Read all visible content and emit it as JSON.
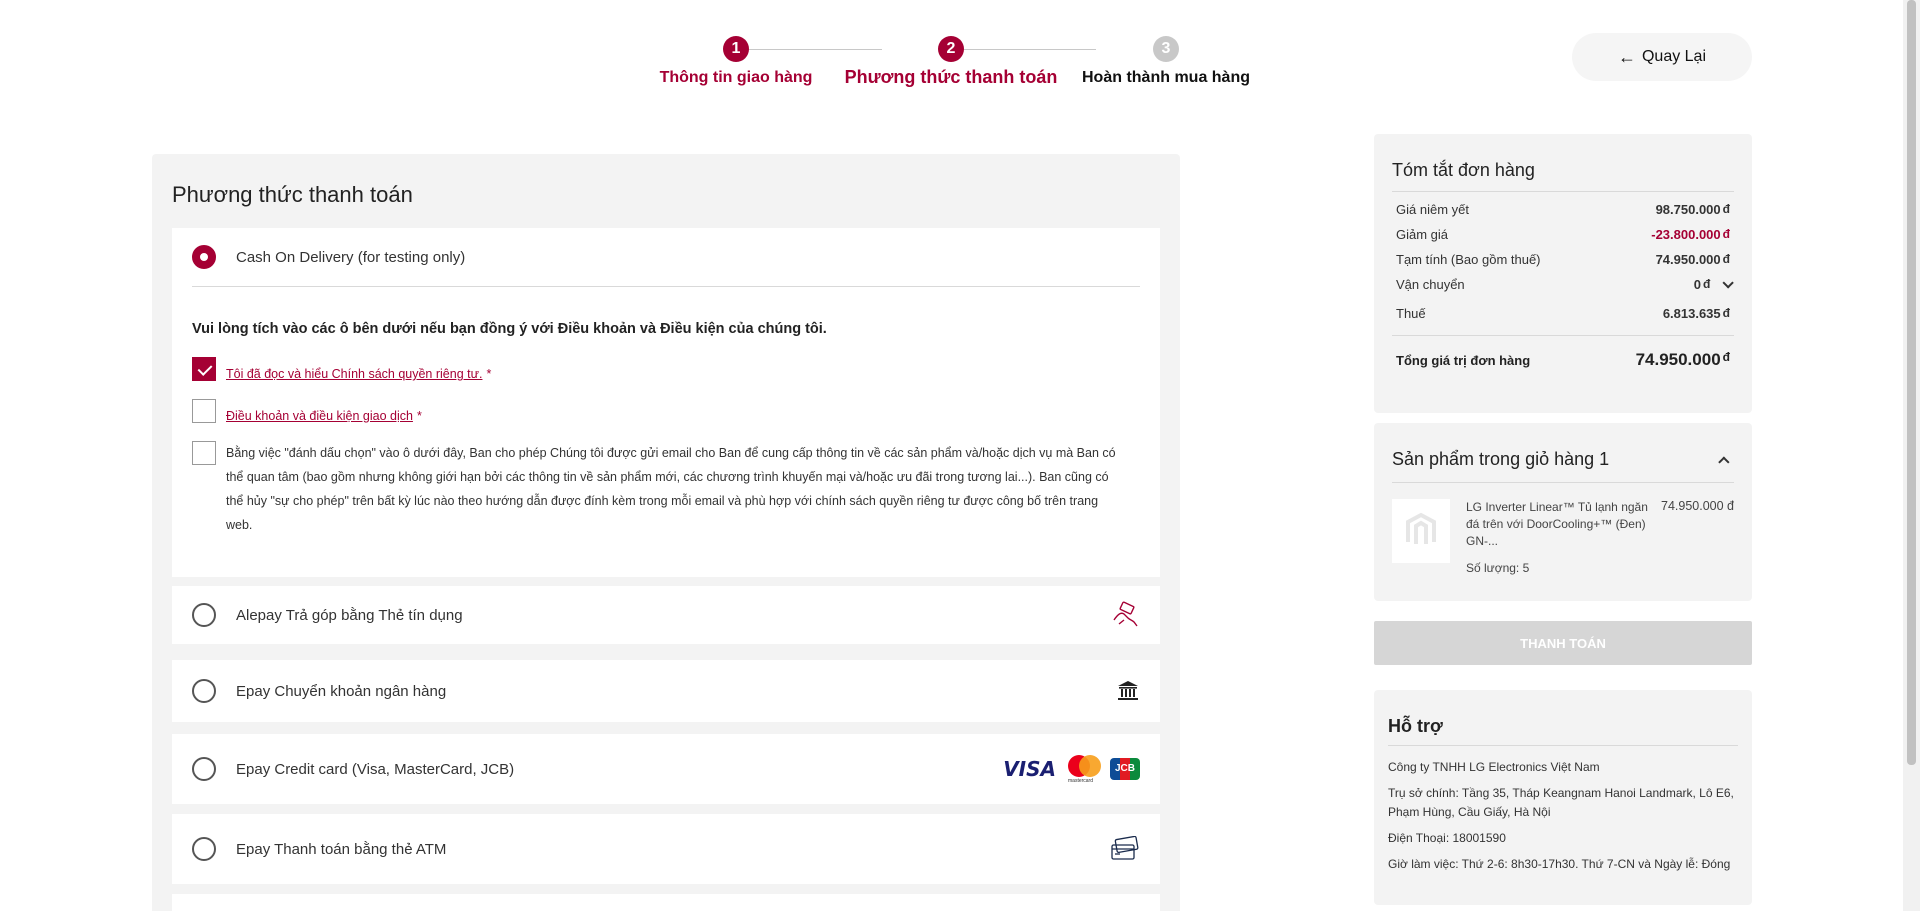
{
  "stepper": {
    "steps": [
      {
        "number": "1",
        "label": "Thông tin giao hàng",
        "state": "done"
      },
      {
        "number": "2",
        "label": "Phương thức thanh toán",
        "state": "current"
      },
      {
        "number": "3",
        "label": "Hoàn thành mua hàng",
        "state": "pending"
      }
    ]
  },
  "header": {
    "back_label": "Quay Lại"
  },
  "payment": {
    "title": "Phương thức thanh toán",
    "methods": [
      {
        "label": "Cash On Delivery (for testing only)",
        "selected": true
      },
      {
        "label": "Alepay Trả góp bằng Thẻ tín dụng",
        "icon": "hand-card-icon"
      },
      {
        "label": "Epay Chuyển khoản ngân hàng",
        "icon": "bank-icon"
      },
      {
        "label": "Epay Credit card (Visa, MasterCard, JCB)",
        "icon": "card-logos"
      },
      {
        "label": "Epay Thanh toán bằng thẻ ATM",
        "icon": "atm-card-icon"
      }
    ],
    "card_logos": {
      "visa": "VISA",
      "jcb": "JCB",
      "mastercard_caption": "mastercard"
    },
    "consent": {
      "title": "Vui lòng tích vào các ô bên dưới nếu bạn đồng ý với Điều khoản và Điều kiện của chúng tôi.",
      "privacy_label": "Tôi đã đọc và hiểu Chính sách quyền riêng tư.",
      "terms_label": "Điều khoản và điều kiện giao dịch",
      "required_mark": "*",
      "marketing_text": "Bằng việc \"đánh dấu chọn\" vào ô dưới đây, Ban cho phép Chúng tôi được gửi email cho Ban để cung cấp thông tin về các sản phẩm và/hoặc dịch vụ mà Ban có thể quan tâm (bao gồm nhưng không giới hạn bởi các thông tin về sản phẩm mới, các chương trình khuyến mại và/hoặc ưu đãi trong tương lai...). Ban cũng có thể hủy \"sự cho phép\" trên bất kỳ lúc nào theo hướng dẫn được đính kèm trong mỗi email và phù hợp với chính sách quyền riêng tư được công bố trên trang web.",
      "privacy_checked": true,
      "terms_checked": false,
      "marketing_checked": false
    }
  },
  "summary": {
    "title": "Tóm tắt đơn hàng",
    "currency": "đ",
    "rows": [
      {
        "label": "Giá niêm yết",
        "value": "98.750.000"
      },
      {
        "label": "Giảm giá",
        "value": "-23.800.000"
      },
      {
        "label": "Tạm tính (Bao gồm thuế)",
        "value": "74.950.000"
      },
      {
        "label": "Vận chuyển",
        "value": "0"
      },
      {
        "label": "Thuế",
        "value": "6.813.635"
      }
    ],
    "total_label": "Tổng giá trị đơn hàng",
    "total_value": "74.950.000"
  },
  "cart": {
    "title": "Sản phẩm trong giỏ hàng 1",
    "items": [
      {
        "name": "LG Inverter Linear™ Tủ lạnh ngăn đá trên với DoorCooling+™ (Đen) GN-...",
        "price": "74.950.000 đ",
        "qty": "Số lượng: 5"
      }
    ]
  },
  "checkout": {
    "label": "THANH TOÁN"
  },
  "support": {
    "title": "Hỗ trợ",
    "company": "Công ty TNHH LG Electronics Việt Nam",
    "address": "Trụ sở chính: Tầng 35, Tháp Keangnam Hanoi Landmark, Lô E6, Phạm Hùng, Cầu Giấy, Hà Nội",
    "phone": "Điện Thoại: 18001590",
    "hours": "Giờ làm việc: Thứ 2-6: 8h30-17h30. Thứ 7-CN và Ngày lễ: Đóng"
  },
  "colors": {
    "accent": "#a50034",
    "panel": "#f3f3f3",
    "disabled": "#d6d6d6"
  }
}
